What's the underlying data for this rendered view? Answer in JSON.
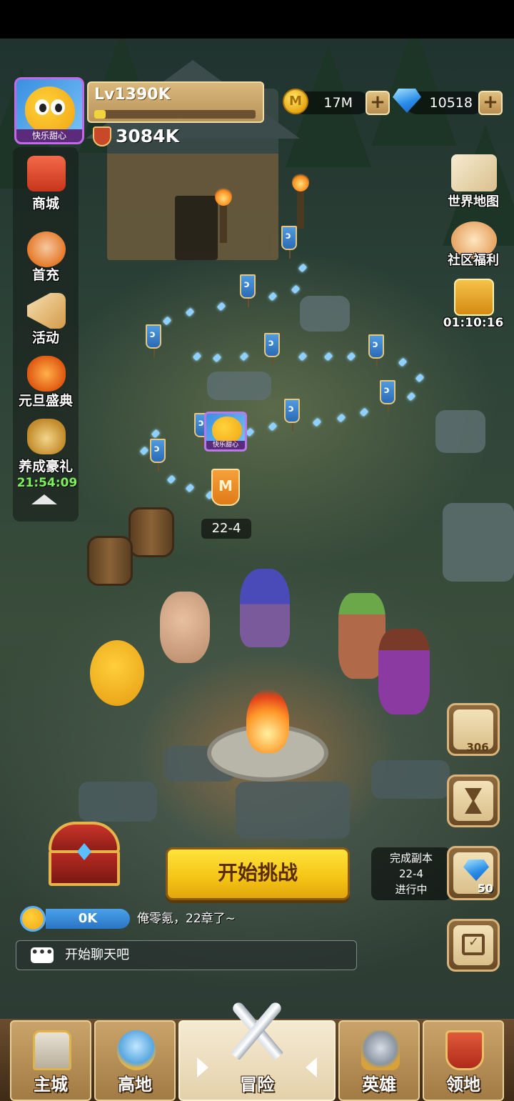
{
  "player": {
    "avatar_name": "快乐甜心",
    "level": "Lv1390K",
    "xp_fraction": 0.07,
    "power": "3084K"
  },
  "resources": {
    "coins": "17M",
    "gems": "10518",
    "coin_glyph": "M"
  },
  "side_menu": [
    {
      "label": "商城",
      "icon": "shop-icon"
    },
    {
      "label": "首充",
      "icon": "first-recharge-icon"
    },
    {
      "label": "活动",
      "icon": "megaphone-icon"
    },
    {
      "label": "元旦盛典",
      "icon": "lantern-icon"
    },
    {
      "label": "养成豪礼",
      "icon": "gift-bag-icon",
      "timer": "21:54:09"
    }
  ],
  "right_menu": [
    {
      "label": "世界地图",
      "icon": "map-icon"
    },
    {
      "label": "社区福利",
      "icon": "chat-bubble-icon"
    },
    {
      "label": "01:10:16",
      "icon": "gift-box-icon"
    }
  ],
  "stage": {
    "marker_name": "快乐甜心",
    "banner_glyph": "M",
    "label": "22-4"
  },
  "side_buttons": {
    "codex_count": "306"
  },
  "start_button": "开始挑战",
  "quest": {
    "line1": "完成副本",
    "line2": "22-4",
    "line3": "进行中",
    "reward": "50"
  },
  "speed": {
    "value": "0K",
    "message": "俺零氪，22章了~"
  },
  "chat": {
    "icon_glyph": "•••",
    "placeholder": "开始聊天吧"
  },
  "nav": [
    {
      "label": "主城",
      "icon": "castle-icon"
    },
    {
      "label": "高地",
      "icon": "highland-icon"
    },
    {
      "label": "冒险",
      "icon": "crossed-swords-icon",
      "active": true
    },
    {
      "label": "英雄",
      "icon": "helmet-icon"
    },
    {
      "label": "领地",
      "icon": "banner-icon"
    }
  ],
  "colors": {
    "start_button": "#f4c414",
    "timer_green": "#7df05a",
    "nav_active": "#f5ead2"
  }
}
